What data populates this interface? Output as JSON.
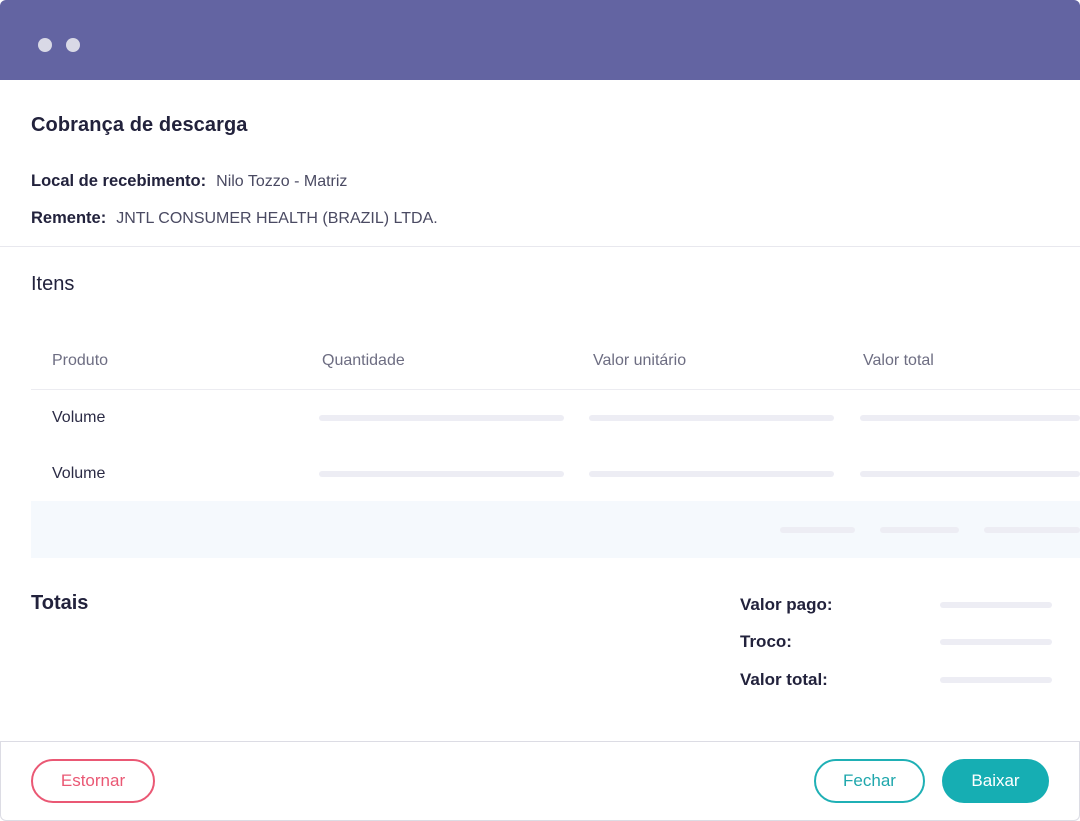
{
  "colors": {
    "titlebar": "#6364a2",
    "accent_teal": "#16aeb3",
    "danger_pink": "#ea5874",
    "footer_row_bg": "#f5f9fd",
    "skeleton": "#ededf4"
  },
  "window": {
    "controls": [
      "window-dot",
      "window-dot"
    ]
  },
  "page": {
    "title": "Cobrança de descarga"
  },
  "info": {
    "local_label": "Local de recebimento:",
    "local_value": "Nilo Tozzo - Matriz",
    "remente_label": "Remente:",
    "remente_value": "JNTL CONSUMER HEALTH (BRAZIL) LTDA."
  },
  "itens": {
    "title": "Itens",
    "columns": [
      "Produto",
      "Quantidade",
      "Valor unitário",
      "Valor total"
    ],
    "rows": [
      {
        "produto": "Volume"
      },
      {
        "produto": "Volume"
      }
    ]
  },
  "totais": {
    "title": "Totais",
    "valor_pago_label": "Valor pago:",
    "troco_label": "Troco:",
    "valor_total_label": "Valor total:"
  },
  "actions": {
    "estornar": "Estornar",
    "fechar": "Fechar",
    "baixar": "Baixar"
  }
}
